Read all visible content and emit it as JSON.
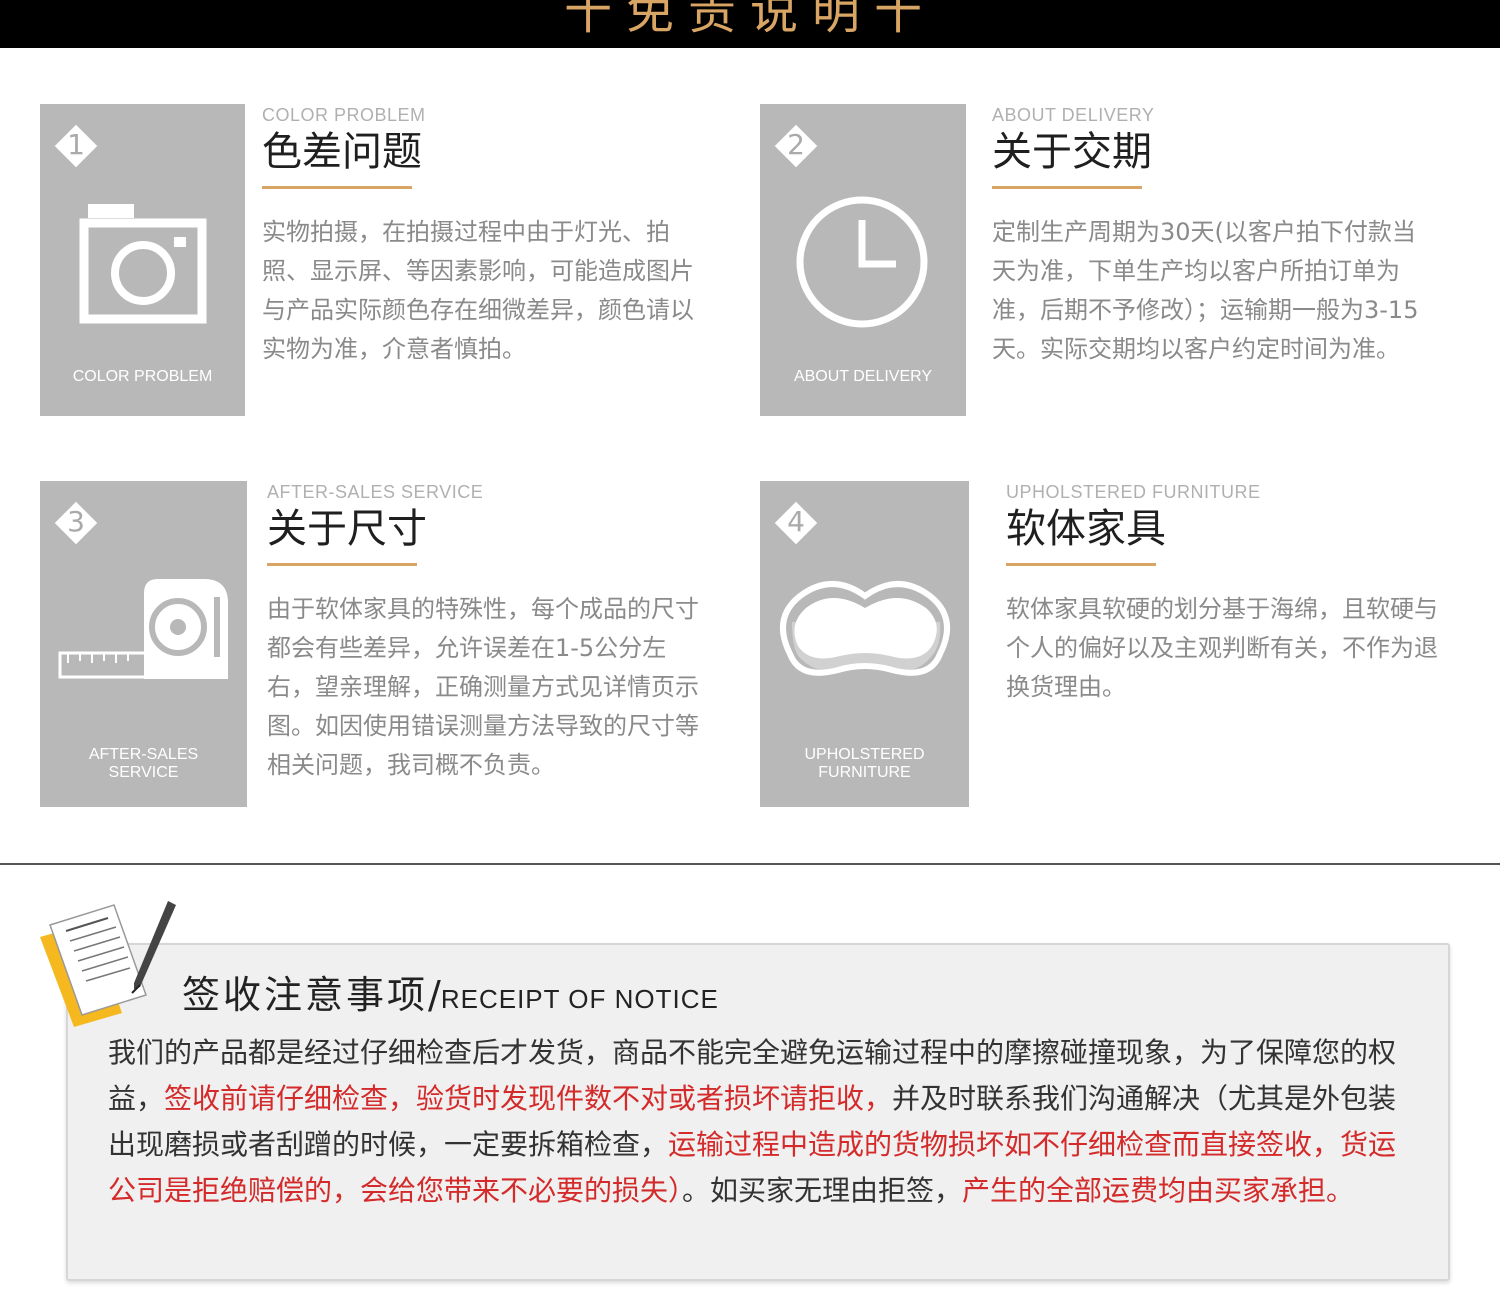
{
  "header": {
    "title": "十免责说明十"
  },
  "items": [
    {
      "number": "1",
      "en": "COLOR PROBLEM",
      "cn": "色差问题",
      "tile_label": "COLOR PROBLEM",
      "icon": "camera-icon",
      "desc": "实物拍摄，在拍摄过程中由于灯光、拍照、显示屏、等因素影响，可能造成图片与产品实际颜色存在细微差异，颜色请以实物为准，介意者慎拍。"
    },
    {
      "number": "2",
      "en": "ABOUT DELIVERY",
      "cn": "关于交期",
      "tile_label": "ABOUT DELIVERY",
      "icon": "clock-icon",
      "desc": "定制生产周期为30天(以客户拍下付款当天为准，下单生产均以客户所拍订单为准，后期不予修改）；运输期一般为3-15天。实际交期均以客户约定时间为准。"
    },
    {
      "number": "3",
      "en": "AFTER-SALES SERVICE",
      "cn": "关于尺寸",
      "tile_label_1": "AFTER-SALES",
      "tile_label_2": "SERVICE",
      "icon": "tape-measure-icon",
      "desc": "由于软体家具的特殊性，每个成品的尺寸都会有些差异，允许误差在1-5公分左右，望亲理解，正确测量方式见详情页示图。如因使用错误测量方法导致的尺寸等相关问题，我司概不负责。"
    },
    {
      "number": "4",
      "en": "UPHOLSTERED FURNITURE",
      "cn": "软体家具",
      "tile_label_1": "UPHOLSTERED",
      "tile_label_2": "FURNITURE",
      "icon": "sponge-icon",
      "desc": "软体家具软硬的划分基于海绵，且软硬与个人的偏好以及主观判断有关，不作为退换货理由。"
    }
  ],
  "notice": {
    "title_cn": "签收注意事项",
    "separator": "/",
    "title_en": "RECEIPT OF NOTICE",
    "icon": "document-pen-icon",
    "segments": [
      {
        "text": "我们的产品都是经过仔细检查后才发货，商品不能完全避免运输过程中的摩擦碰撞现象，为了保障您的权益，",
        "highlight": false
      },
      {
        "text": "签收前请仔细检查，验货时发现件数不对或者损坏请拒收，",
        "highlight": true
      },
      {
        "text": "并及时联系我们沟通解决（尤其是外包装出现磨损或者刮蹭的时候，一定要拆箱检查，",
        "highlight": false
      },
      {
        "text": "运输过程中造成的货物损坏如不仔细检查而直接签收，货运公司是拒绝赔偿的，会给您带来不必要的损失）",
        "highlight": true
      },
      {
        "text": "。如买家无理由拒签，",
        "highlight": false
      },
      {
        "text": "产生的全部运费均由买家承担。",
        "highlight": true
      }
    ]
  },
  "colors": {
    "accent": "#d9a564",
    "tile": "#b8b8b8",
    "highlight": "#d42a2a"
  }
}
